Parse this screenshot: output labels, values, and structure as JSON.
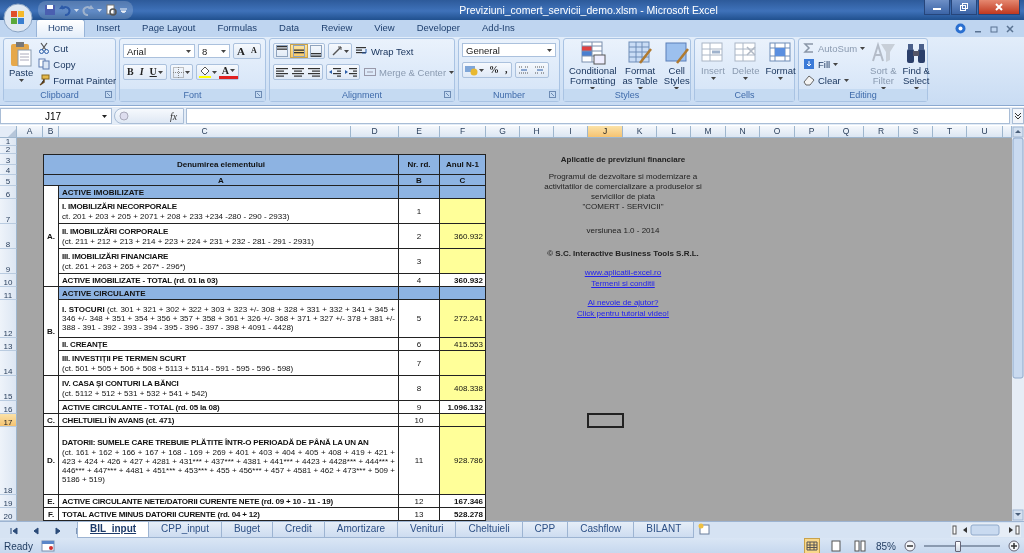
{
  "window": {
    "title": "Previziuni_comert_servicii_demo.xlsm - Microsoft Excel"
  },
  "tabs": [
    {
      "label": "Home",
      "selected": true
    },
    {
      "label": "Insert",
      "selected": false
    },
    {
      "label": "Page Layout",
      "selected": false
    },
    {
      "label": "Formulas",
      "selected": false
    },
    {
      "label": "Data",
      "selected": false
    },
    {
      "label": "Review",
      "selected": false
    },
    {
      "label": "View",
      "selected": false
    },
    {
      "label": "Developer",
      "selected": false
    },
    {
      "label": "Add-Ins",
      "selected": false
    }
  ],
  "ribbon": {
    "clipboard": {
      "label": "Clipboard",
      "paste": "Paste",
      "small": [
        "Cut",
        "Copy",
        "Format Painter"
      ]
    },
    "font": {
      "label": "Font",
      "font_name": "Arial",
      "font_size": "8",
      "grow": "A",
      "shrink": "A",
      "bold": "B",
      "italic": "I",
      "underline": "U",
      "font_color": "A"
    },
    "alignment": {
      "label": "Alignment",
      "vertical": [
        {
          "selected": false
        },
        {
          "selected": true
        },
        {
          "selected": false
        }
      ],
      "wrap_text": "Wrap Text",
      "merge": {
        "label": "Merge & Center",
        "disabled": true
      }
    },
    "number": {
      "label": "Number",
      "format": "General",
      "percent": "%",
      "comma": ","
    },
    "styles": {
      "label": "Styles",
      "buttons": [
        "Conditional\nFormatting",
        "Format\nas Table",
        "Cell\nStyles"
      ]
    },
    "cells": {
      "label": "Cells",
      "buttons": [
        {
          "label": "Insert",
          "disabled": true
        },
        {
          "label": "Delete",
          "disabled": true
        },
        {
          "label": "Format",
          "disabled": false
        }
      ]
    },
    "editing": {
      "label": "Editing",
      "small": [
        {
          "label": "AutoSum",
          "disabled": true
        },
        {
          "label": "Fill",
          "disabled": false
        },
        {
          "label": "Clear",
          "disabled": false
        }
      ],
      "large": [
        {
          "label": "Sort &\nFilter",
          "disabled": true
        },
        {
          "label": "Find &\nSelect",
          "disabled": false
        }
      ]
    }
  },
  "formula_bar": {
    "name_box": "J17",
    "fx": "fx"
  },
  "columns": [
    {
      "label": "A",
      "selected": false
    },
    {
      "label": "B",
      "selected": false
    },
    {
      "label": "C",
      "selected": false
    },
    {
      "label": "D",
      "selected": false
    },
    {
      "label": "E",
      "selected": false
    },
    {
      "label": "F",
      "selected": false
    },
    {
      "label": "G",
      "selected": false
    },
    {
      "label": "H",
      "selected": false
    },
    {
      "label": "I",
      "selected": false
    },
    {
      "label": "J",
      "selected": true
    },
    {
      "label": "K",
      "selected": false
    },
    {
      "label": "L",
      "selected": false
    },
    {
      "label": "M",
      "selected": false
    },
    {
      "label": "N",
      "selected": false
    },
    {
      "label": "O",
      "selected": false
    },
    {
      "label": "P",
      "selected": false
    },
    {
      "label": "Q",
      "selected": false
    },
    {
      "label": "R",
      "selected": false
    },
    {
      "label": "S",
      "selected": false
    },
    {
      "label": "T",
      "selected": false
    },
    {
      "label": "U",
      "selected": false
    }
  ],
  "rows": [
    {
      "label": "1",
      "selected": false
    },
    {
      "label": "2",
      "selected": false
    },
    {
      "label": "3",
      "selected": false
    },
    {
      "label": "4",
      "selected": false
    },
    {
      "label": "5",
      "selected": false
    },
    {
      "label": "6",
      "selected": false
    },
    {
      "label": "7",
      "selected": false
    },
    {
      "label": "8",
      "selected": false
    },
    {
      "label": "9",
      "selected": false
    },
    {
      "label": "10",
      "selected": false
    },
    {
      "label": "11",
      "selected": false
    },
    {
      "label": "12",
      "selected": false
    },
    {
      "label": "13",
      "selected": false
    },
    {
      "label": "14",
      "selected": false
    },
    {
      "label": "15",
      "selected": false
    },
    {
      "label": "16",
      "selected": false
    },
    {
      "label": "17",
      "selected": true
    },
    {
      "label": "18",
      "selected": false
    },
    {
      "label": "19",
      "selected": false
    },
    {
      "label": "20",
      "selected": false
    }
  ],
  "table": {
    "header": {
      "name": "Denumirea elementului",
      "nr": "Nr. rd.",
      "year": "Anul N-1"
    },
    "codes": [
      "A",
      "B",
      "C"
    ],
    "groups": [
      {
        "letter": "A.",
        "rows": [
          {
            "kind": "section",
            "label": "ACTIVE IMOBILIZATE"
          },
          {
            "kind": "item",
            "label": "I. IMOBILIZĂRI NECORPORALE",
            "formula": "ct. 201 + 203 + 205 + 2071 + 208 + 233 +234 -280 - 290 - 2933)",
            "nr": "1"
          },
          {
            "kind": "item",
            "label": "II. IMOBILIZĂRI CORPORALE",
            "formula": "(ct. 211 + 212 + 213 + 214 + 223 + 224 + 231 + 232 - 281 - 291 - 2931)",
            "nr": "2",
            "value": "360.932"
          },
          {
            "kind": "item",
            "label": "III. IMOBILIZĂRI FINANCIARE",
            "formula": "(ct. 261 + 263 + 265 + 267* - 296*)",
            "nr": "3"
          },
          {
            "kind": "total",
            "label": "ACTIVE IMOBILIZATE - TOTAL (rd. 01 la 03)",
            "nr": "4",
            "value": "360.932"
          }
        ]
      },
      {
        "letter": "B.",
        "rows": [
          {
            "kind": "section",
            "label": "ACTIVE CIRCULANTE"
          },
          {
            "kind": "inline",
            "label": "**I. STOCURI** (ct. 301 + 321 + 302 + 322 + 303 + 323 +/- 308 + 328 + 331 + 332 + 341 + 345 + 346 +/- 348 + 351 + 354 + 356 + 357 + 358 + 361 + 326 +/- 368 + 371 + 327 +/- 378 + 381 +/- 388 - 391 - 392 - 393 - 394 - 395 - 396 - 397 - 398 + 4091 - 4428)",
            "nr": "5",
            "value": "272.241"
          },
          {
            "kind": "item",
            "label": "II. CREANȚE",
            "nr": "6",
            "value": "415.553"
          },
          {
            "kind": "item",
            "label": "III. INVESTIȚII PE TERMEN SCURT",
            "formula": "(ct. 501 + 505 + 506 + 508 + 5113 + 5114 - 591 - 595 - 596 - 598)",
            "nr": "7"
          }
        ]
      },
      {
        "rows": [
          {
            "kind": "item",
            "label": "IV. CASA ȘI CONTURI LA BĂNCI",
            "formula": "(ct. 5112 + 512 + 531 + 532 + 541 + 542)",
            "nr": "8",
            "value": "408.338"
          },
          {
            "kind": "total",
            "label": "ACTIVE CIRCULANTE - TOTAL (rd. 05 la 08)",
            "nr": "9",
            "value": "1.096.132"
          }
        ]
      },
      {
        "letter": "C.",
        "rows": [
          {
            "kind": "item",
            "label": "CHELTUIELI ÎN AVANS (ct. 471)",
            "nr": "10"
          }
        ]
      },
      {
        "letter": "D.",
        "rows": [
          {
            "kind": "item",
            "label": "DATORII: SUMELE CARE TREBUIE PLĂTITE ÎNTR-O PERIOADĂ DE PÂNĂ LA UN AN",
            "formula": "(ct. 161 + 162 + 166 + 167 + 168 - 169 + 269 + 401 + 403 + 404 + 405 + 408 + 419 + 421 + 423 + 424 + 426 + 427 + 4281 + 431*** + 437*** + 4381 + 441*** + 4423 + 4428*** + 444*** + 446*** + 447*** + 4481 + 451*** + 453*** + 455 + 456*** + 457 + 4581 + 462 + 473*** + 509 + 5186 + 519)",
            "nr": "11",
            "value": "928.786"
          }
        ]
      },
      {
        "letter": "E.",
        "rows": [
          {
            "kind": "total",
            "label": "ACTIVE CIRCULANTE NETE/DATORII CURENTE NETE (rd. 09 + 10 - 11 - 19)",
            "nr": "12",
            "value": "167.346"
          }
        ]
      },
      {
        "letter": "F.",
        "rows": [
          {
            "kind": "total",
            "label": "TOTAL ACTIVE MINUS DATORII CURENTE (rd. 04 + 12)",
            "nr": "13",
            "value": "528.278"
          }
        ]
      }
    ]
  },
  "info": {
    "title": "Aplicatie de previziuni financiare",
    "description": "Programul de dezvoltare si modernizare a\nactivitatilor de comercializare a produselor si\nserviciilor de piata\n\"COMERT - SERVICII\"",
    "version": "versiunea 1.0 - 2014",
    "copyright": "© S.C. Interactive Business Tools S.R.L.",
    "links": [
      "www.aplicatii-excel.ro",
      "Termeni si conditii"
    ],
    "help_links": [
      "Ai nevoie de ajutor?",
      "Click pentru tutorial video!"
    ]
  },
  "sheet_tabs": [
    {
      "label": "BIL_input",
      "selected": true
    },
    {
      "label": "CPP_input",
      "selected": false
    },
    {
      "label": "Buget",
      "selected": false
    },
    {
      "label": "Credit",
      "selected": false
    },
    {
      "label": "Amortizare",
      "selected": false
    },
    {
      "label": "Venituri",
      "selected": false
    },
    {
      "label": "Cheltuieli",
      "selected": false
    },
    {
      "label": "CPP",
      "selected": false
    },
    {
      "label": "Cashflow",
      "selected": false
    },
    {
      "label": "BILANT",
      "selected": false
    }
  ],
  "status_bar": {
    "status": "Ready",
    "views": [
      {
        "selected": true
      },
      {
        "selected": false
      },
      {
        "selected": false
      }
    ],
    "zoom": "85%",
    "zoom_level": {
      "level": 0.45
    }
  }
}
